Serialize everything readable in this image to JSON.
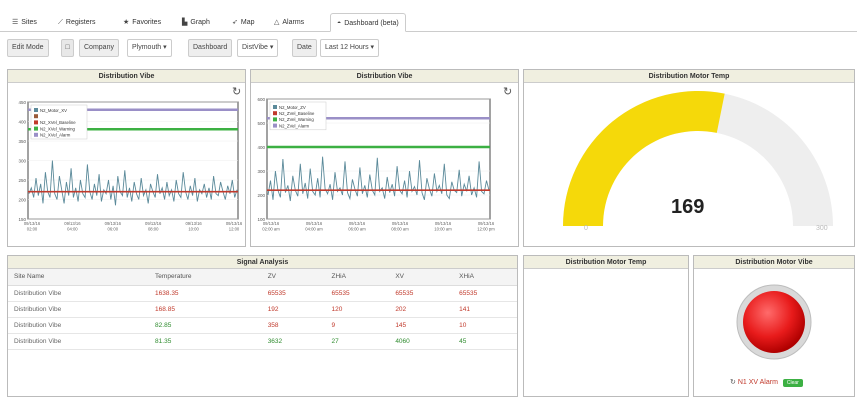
{
  "tabs": [
    {
      "label": "Sites",
      "icon": "list-icon"
    },
    {
      "label": "Registers",
      "icon": "line-chart-icon"
    },
    {
      "label": "Favorites",
      "icon": "star-icon"
    },
    {
      "label": "Graph",
      "icon": "bar-chart-icon"
    },
    {
      "label": "Map",
      "icon": "map-pin-icon"
    },
    {
      "label": "Alarms",
      "icon": "bell-icon"
    },
    {
      "label": "Dashboard (beta)",
      "icon": "dashboard-icon"
    }
  ],
  "toolbar": {
    "edit_mode": "Edit Mode",
    "company_label": "Company",
    "company_value": "Plymouth ▾",
    "dashboard_label": "Dashboard",
    "dashboard_value": "DistVibe ▾",
    "date_label": "Date",
    "date_value": "Last 12 Hours ▾"
  },
  "panels": {
    "vibe1_title": "Distribution Vibe",
    "vibe2_title": "Distribution Vibe",
    "temp_title": "Distribution Motor Temp",
    "signal_title": "Signal Analysis",
    "temp2_title": "Distribution Motor Temp",
    "vibe_status_title": "Distribution Motor Vibe"
  },
  "colors": {
    "signal": "#5b8a9a",
    "baseline": "#c0392b",
    "warning": "#3cb043",
    "alarm": "#9a8fc7",
    "gauge_fill": "#f5d90a",
    "gauge_track": "#eeeeee",
    "status_light": "#e81b1b"
  },
  "chart_data": [
    {
      "type": "line",
      "legend": [
        "N2_Motor_XV",
        "",
        "N2_XVel_Baseline",
        "N2_XVel_Warning",
        "N2_XVel_Alarm"
      ],
      "ylim": [
        150,
        450
      ],
      "yticks": [
        "450",
        "400",
        "350",
        "300",
        "250",
        "200",
        "150"
      ],
      "xticks": [
        "09/13/16\n02:00",
        "09/13/16\n04:00",
        "09/13/16\n06:00",
        "09/13/16\n08:00",
        "09/13/16\n10:00",
        "09/13/16\n12:00"
      ],
      "baseline": 220,
      "warning": 380,
      "alarm": 430,
      "series_values": [
        215,
        230,
        205,
        255,
        210,
        240,
        190,
        270,
        220,
        205,
        300,
        215,
        200,
        260,
        225,
        190,
        245,
        210,
        280,
        205,
        230,
        195,
        250,
        215,
        205,
        290,
        220,
        200,
        240,
        210,
        265,
        195,
        225,
        215,
        250,
        200,
        235,
        185,
        260,
        220,
        210,
        275,
        205,
        230,
        195,
        245,
        215,
        200,
        255,
        210,
        225,
        190,
        240,
        220,
        205,
        265,
        215,
        230,
        200,
        245,
        210,
        225,
        195,
        250,
        215,
        205,
        270,
        220,
        200,
        235,
        210,
        255,
        195,
        225,
        215,
        240,
        205,
        230,
        200,
        260,
        215,
        210,
        245,
        220,
        200,
        235,
        215,
        250,
        205,
        225
      ]
    },
    {
      "type": "line",
      "legend": [
        "N2_Motor_ZV",
        "N2_ZVel_Baseline",
        "N2_ZVel_Warning",
        "N2_ZVel_Alarm"
      ],
      "ylim": [
        100,
        600
      ],
      "yticks": [
        "600",
        "500",
        "400",
        "300",
        "200",
        "100"
      ],
      "xticks": [
        "09/13/16\n02:00 am",
        "09/13/16\n04:00 am",
        "09/13/16\n06:00 am",
        "09/13/16\n08:00 am",
        "09/13/16\n10:00 am",
        "09/13/16\n12:00 pm"
      ],
      "baseline": 220,
      "warning": 400,
      "alarm": 520,
      "series_values": [
        200,
        260,
        180,
        300,
        220,
        190,
        350,
        210,
        240,
        175,
        280,
        220,
        195,
        330,
        205,
        250,
        185,
        310,
        215,
        200,
        270,
        190,
        360,
        225,
        205,
        245,
        180,
        295,
        215,
        230,
        200,
        340,
        210,
        185,
        265,
        225,
        195,
        315,
        205,
        240,
        190,
        285,
        220,
        200,
        355,
        215,
        230,
        185,
        275,
        210,
        245,
        195,
        320,
        220,
        205,
        260,
        190,
        300,
        215,
        235,
        200,
        345,
        210,
        180,
        270,
        225,
        195,
        290,
        215,
        240,
        205,
        330,
        200,
        185,
        255,
        220,
        210,
        305,
        195,
        245,
        215,
        280,
        200,
        230,
        190,
        340,
        215,
        205,
        260,
        220
      ]
    },
    {
      "type": "gauge",
      "value": 169,
      "min": 0,
      "max": 300,
      "value_label": "169",
      "min_label": "0",
      "max_label": "300"
    }
  ],
  "signal_table": {
    "headers": [
      "Site Name",
      "Temperature",
      "ZV",
      "ZHiA",
      "XV",
      "XHiA"
    ],
    "rows": [
      {
        "site": "Distribution Vibe",
        "temperature": "1638.35",
        "zv": "65535",
        "zhia": "65535",
        "xv": "65535",
        "xhia": "65535",
        "color": "red"
      },
      {
        "site": "Distribution Vibe",
        "temperature": "168.85",
        "zv": "192",
        "zhia": "120",
        "xv": "202",
        "xhia": "141",
        "color": "red"
      },
      {
        "site": "Distribution Vibe",
        "temperature": "82.85",
        "zv": "358",
        "zhia": "9",
        "xv": "145",
        "xhia": "10",
        "color": "mixed"
      },
      {
        "site": "Distribution Vibe",
        "temperature": "81.35",
        "zv": "3632",
        "zhia": "27",
        "xv": "4060",
        "xhia": "45",
        "color": "green"
      }
    ]
  },
  "status": {
    "alarm_label": "N1 XV Alarm",
    "badge": "Clear"
  }
}
